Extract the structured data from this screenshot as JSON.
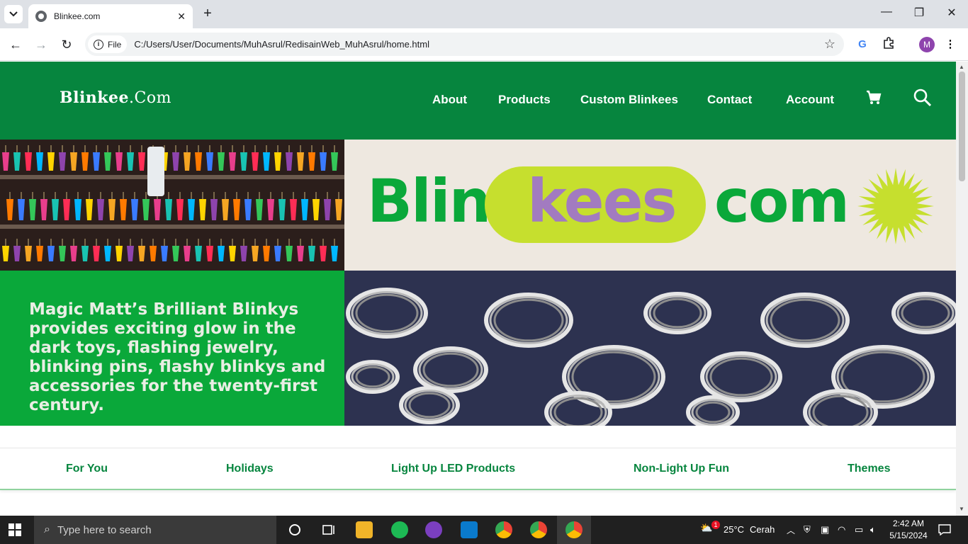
{
  "browser": {
    "tab_title": "Blinkee.com",
    "new_tab": "+",
    "chip_label": "File",
    "url": "C:/Users/User/Documents/MuhAsrul/RedisainWeb_MuhAsrul/home.html",
    "profile_initial": "M"
  },
  "site": {
    "logo_main": "Blinkee",
    "logo_dotcom": ".Com",
    "nav": [
      "About",
      "Products",
      "Custom Blinkees",
      "Contact",
      "Account"
    ],
    "hero_text": "Magic Matt’s Brilliant Blinkys provides exciting glow in the dark toys, flashing jewelry, blinking pins, flashy blinkys and accessories for the twenty-first century.",
    "brand": {
      "part1": "Blin",
      "part2": "kees",
      "part3": "com"
    },
    "categories": [
      "For You",
      "Holidays",
      "Light Up LED Products",
      "Non-Light Up Fun",
      "Themes"
    ]
  },
  "taskbar": {
    "search_placeholder": "Type here to search",
    "weather_temp": "25°C",
    "weather_text": "Cerah",
    "weather_badge": "1",
    "time": "2:42 AM",
    "date": "5/15/2024"
  },
  "colors": {
    "header_green": "#06853e",
    "hero_green": "#0aa83a",
    "pill_lime": "#c6df2e",
    "kees_purple": "#a27bc0"
  }
}
